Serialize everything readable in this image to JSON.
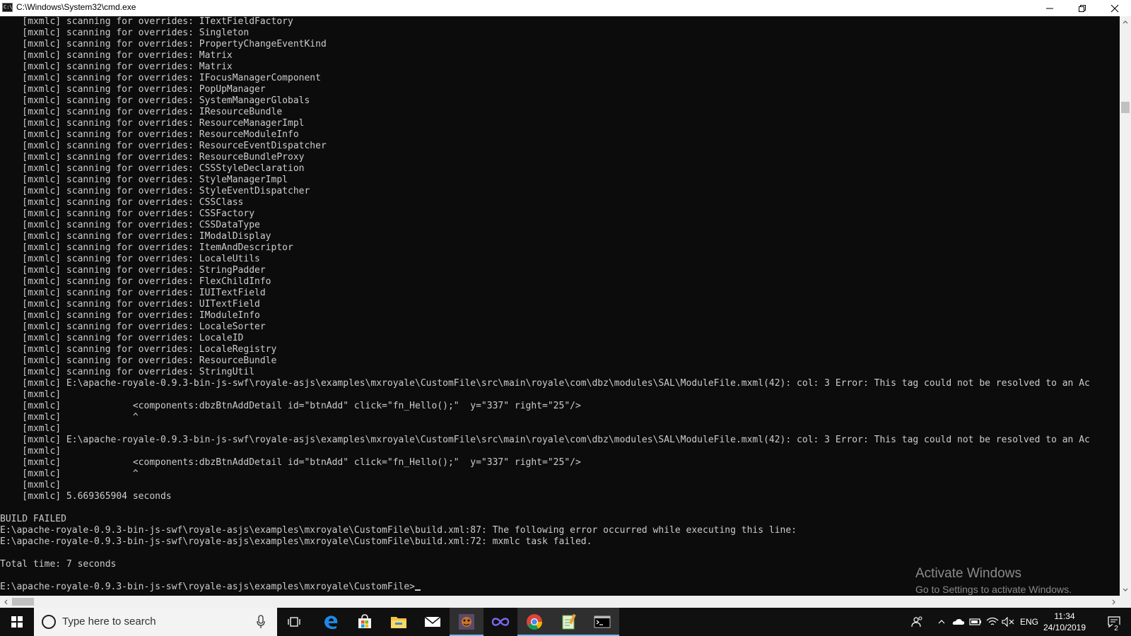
{
  "window": {
    "title": "C:\\Windows\\System32\\cmd.exe",
    "icon_label": "C:\\",
    "icons": {
      "minimize": "minimize-icon",
      "maximize": "restore-icon",
      "close": "close-icon"
    }
  },
  "console": {
    "lines": [
      "    [mxmlc] scanning for overrides: ITextFieldFactory",
      "    [mxmlc] scanning for overrides: Singleton",
      "    [mxmlc] scanning for overrides: PropertyChangeEventKind",
      "    [mxmlc] scanning for overrides: Matrix",
      "    [mxmlc] scanning for overrides: Matrix",
      "    [mxmlc] scanning for overrides: IFocusManagerComponent",
      "    [mxmlc] scanning for overrides: PopUpManager",
      "    [mxmlc] scanning for overrides: SystemManagerGlobals",
      "    [mxmlc] scanning for overrides: IResourceBundle",
      "    [mxmlc] scanning for overrides: ResourceManagerImpl",
      "    [mxmlc] scanning for overrides: ResourceModuleInfo",
      "    [mxmlc] scanning for overrides: ResourceEventDispatcher",
      "    [mxmlc] scanning for overrides: ResourceBundleProxy",
      "    [mxmlc] scanning for overrides: CSSStyleDeclaration",
      "    [mxmlc] scanning for overrides: StyleManagerImpl",
      "    [mxmlc] scanning for overrides: StyleEventDispatcher",
      "    [mxmlc] scanning for overrides: CSSClass",
      "    [mxmlc] scanning for overrides: CSSFactory",
      "    [mxmlc] scanning for overrides: CSSDataType",
      "    [mxmlc] scanning for overrides: IModalDisplay",
      "    [mxmlc] scanning for overrides: ItemAndDescriptor",
      "    [mxmlc] scanning for overrides: LocaleUtils",
      "    [mxmlc] scanning for overrides: StringPadder",
      "    [mxmlc] scanning for overrides: FlexChildInfo",
      "    [mxmlc] scanning for overrides: IUITextField",
      "    [mxmlc] scanning for overrides: UITextField",
      "    [mxmlc] scanning for overrides: IModuleInfo",
      "    [mxmlc] scanning for overrides: LocaleSorter",
      "    [mxmlc] scanning for overrides: LocaleID",
      "    [mxmlc] scanning for overrides: LocaleRegistry",
      "    [mxmlc] scanning for overrides: ResourceBundle",
      "    [mxmlc] scanning for overrides: StringUtil",
      "    [mxmlc] E:\\apache-royale-0.9.3-bin-js-swf\\royale-asjs\\examples\\mxroyale\\CustomFile\\src\\main\\royale\\com\\dbz\\modules\\SAL\\ModuleFile.mxml(42): col: 3 Error: This tag could not be resolved to an Ac",
      "    [mxmlc]",
      "    [mxmlc]             <components:dbzBtnAddDetail id=\"btnAdd\" click=\"fn_Hello();\"  y=\"337\" right=\"25\"/>",
      "    [mxmlc]             ^",
      "    [mxmlc]",
      "    [mxmlc] E:\\apache-royale-0.9.3-bin-js-swf\\royale-asjs\\examples\\mxroyale\\CustomFile\\src\\main\\royale\\com\\dbz\\modules\\SAL\\ModuleFile.mxml(42): col: 3 Error: This tag could not be resolved to an Ac",
      "    [mxmlc]",
      "    [mxmlc]             <components:dbzBtnAddDetail id=\"btnAdd\" click=\"fn_Hello();\"  y=\"337\" right=\"25\"/>",
      "    [mxmlc]             ^",
      "    [mxmlc]",
      "    [mxmlc] 5.669365904 seconds",
      "",
      "BUILD FAILED",
      "E:\\apache-royale-0.9.3-bin-js-swf\\royale-asjs\\examples\\mxroyale\\CustomFile\\build.xml:87: The following error occurred while executing this line:",
      "E:\\apache-royale-0.9.3-bin-js-swf\\royale-asjs\\examples\\mxroyale\\CustomFile\\build.xml:72: mxmlc task failed.",
      "",
      "Total time: 7 seconds",
      "",
      "E:\\apache-royale-0.9.3-bin-js-swf\\royale-asjs\\examples\\mxroyale\\CustomFile>"
    ]
  },
  "watermark": {
    "title": "Activate Windows",
    "subtitle": "Go to Settings to activate Windows."
  },
  "taskbar": {
    "search_placeholder": "Type here to search",
    "apps": [
      {
        "name": "task-view-icon"
      },
      {
        "name": "edge-icon"
      },
      {
        "name": "store-icon"
      },
      {
        "name": "file-explorer-icon"
      },
      {
        "name": "mail-icon"
      },
      {
        "name": "game-app-icon"
      },
      {
        "name": "vs-code-icon"
      },
      {
        "name": "chrome-icon"
      },
      {
        "name": "notepad-icon"
      },
      {
        "name": "cmd-icon"
      }
    ],
    "tray": {
      "language": "ENG",
      "time": "11:34",
      "date": "24/10/2019",
      "notification_count": "2"
    }
  },
  "colors": {
    "console_bg": "#0c0c0c",
    "console_text": "#cccccc",
    "taskbar_bg": "#101010",
    "active_indicator": "#76b9ed"
  }
}
